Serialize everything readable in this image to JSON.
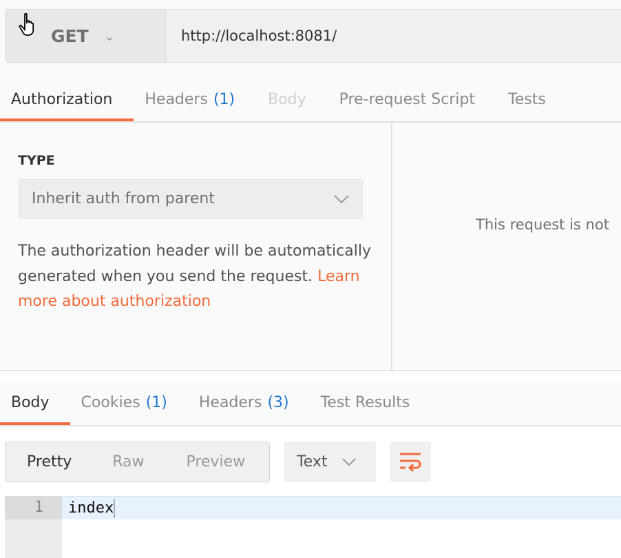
{
  "request": {
    "method": "GET",
    "url": "http://localhost:8081/"
  },
  "request_tabs": [
    {
      "label": "Authorization",
      "active": true
    },
    {
      "label": "Headers",
      "count": "(1)"
    },
    {
      "label": "Body",
      "disabled": true
    },
    {
      "label": "Pre-request Script"
    },
    {
      "label": "Tests"
    }
  ],
  "auth": {
    "type_label": "TYPE",
    "type_value": "Inherit auth from parent",
    "description": "The authorization header will be automatically generated when you send the request.",
    "link": "Learn more about authorization",
    "right_message": "This request is not"
  },
  "response_tabs": [
    {
      "label": "Body",
      "active": true
    },
    {
      "label": "Cookies",
      "count": "(1)"
    },
    {
      "label": "Headers",
      "count": "(3)"
    },
    {
      "label": "Test Results"
    }
  ],
  "response": {
    "views": [
      "Pretty",
      "Raw",
      "Preview"
    ],
    "selected_view": "Pretty",
    "format": "Text",
    "line_number": "1",
    "body": "index"
  },
  "colors": {
    "accent": "#f26b3a",
    "count": "#1e77d0"
  },
  "icons": {
    "method_dropdown": "chevron-down-icon",
    "wrap": "wrap-lines-icon",
    "cursor": "hand-pointer-icon"
  }
}
